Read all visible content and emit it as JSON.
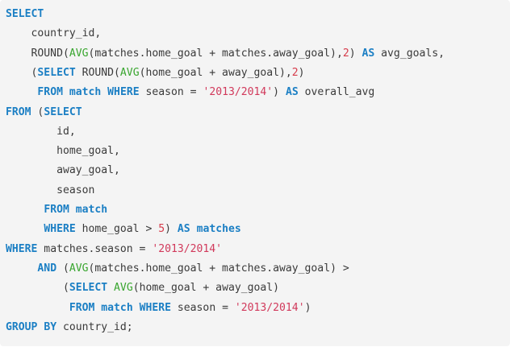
{
  "code": {
    "lines": [
      [
        {
          "t": "SELECT",
          "k": "kw"
        }
      ],
      [
        {
          "t": "    country_id,"
        }
      ],
      [
        {
          "t": "    ROUND("
        },
        {
          "t": "AVG",
          "k": "fn"
        },
        {
          "t": "(matches.home_goal + matches.away_goal),"
        },
        {
          "t": "2",
          "k": "num"
        },
        {
          "t": ") "
        },
        {
          "t": "AS",
          "k": "kw"
        },
        {
          "t": " avg_goals,"
        }
      ],
      [
        {
          "t": "    ("
        },
        {
          "t": "SELECT",
          "k": "kw"
        },
        {
          "t": " ROUND("
        },
        {
          "t": "AVG",
          "k": "fn"
        },
        {
          "t": "(home_goal + away_goal),"
        },
        {
          "t": "2",
          "k": "num"
        },
        {
          "t": ")"
        }
      ],
      [
        {
          "t": "     "
        },
        {
          "t": "FROM",
          "k": "kw"
        },
        {
          "t": " "
        },
        {
          "t": "match",
          "k": "kw"
        },
        {
          "t": " "
        },
        {
          "t": "WHERE",
          "k": "kw"
        },
        {
          "t": " season = "
        },
        {
          "t": "'2013/2014'",
          "k": "str"
        },
        {
          "t": ") "
        },
        {
          "t": "AS",
          "k": "kw"
        },
        {
          "t": " overall_avg"
        }
      ],
      [
        {
          "t": "FROM",
          "k": "kw"
        },
        {
          "t": " ("
        },
        {
          "t": "SELECT",
          "k": "kw"
        }
      ],
      [
        {
          "t": "        id,"
        }
      ],
      [
        {
          "t": "        home_goal,"
        }
      ],
      [
        {
          "t": "        away_goal,"
        }
      ],
      [
        {
          "t": "        season"
        }
      ],
      [
        {
          "t": "      "
        },
        {
          "t": "FROM",
          "k": "kw"
        },
        {
          "t": " "
        },
        {
          "t": "match",
          "k": "kw"
        }
      ],
      [
        {
          "t": "      "
        },
        {
          "t": "WHERE",
          "k": "kw"
        },
        {
          "t": " home_goal > "
        },
        {
          "t": "5",
          "k": "num"
        },
        {
          "t": ") "
        },
        {
          "t": "AS",
          "k": "kw"
        },
        {
          "t": " "
        },
        {
          "t": "matches",
          "k": "kw"
        }
      ],
      [
        {
          "t": "WHERE",
          "k": "kw"
        },
        {
          "t": " matches.season = "
        },
        {
          "t": "'2013/2014'",
          "k": "str"
        }
      ],
      [
        {
          "t": "     "
        },
        {
          "t": "AND",
          "k": "kw"
        },
        {
          "t": " ("
        },
        {
          "t": "AVG",
          "k": "fn"
        },
        {
          "t": "(matches.home_goal + matches.away_goal) >"
        }
      ],
      [
        {
          "t": "         ("
        },
        {
          "t": "SELECT",
          "k": "kw"
        },
        {
          "t": " "
        },
        {
          "t": "AVG",
          "k": "fn"
        },
        {
          "t": "(home_goal + away_goal)"
        }
      ],
      [
        {
          "t": "          "
        },
        {
          "t": "FROM",
          "k": "kw"
        },
        {
          "t": " "
        },
        {
          "t": "match",
          "k": "kw"
        },
        {
          "t": " "
        },
        {
          "t": "WHERE",
          "k": "kw"
        },
        {
          "t": " season = "
        },
        {
          "t": "'2013/2014'",
          "k": "str"
        },
        {
          "t": ")"
        }
      ],
      [
        {
          "t": "GROUP",
          "k": "kw"
        },
        {
          "t": " "
        },
        {
          "t": "BY",
          "k": "kw"
        },
        {
          "t": " country_id;"
        }
      ]
    ]
  }
}
